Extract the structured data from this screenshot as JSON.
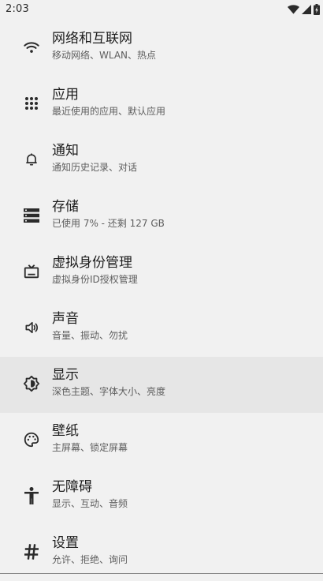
{
  "status_bar": {
    "time": "2:03",
    "icons": [
      "wifi-icon",
      "cell-signal-icon",
      "battery-icon"
    ]
  },
  "colors": {
    "background": "#f1f1f1",
    "highlight": "#e6e6e6",
    "title_text": "#1c1c1c",
    "subtitle_text": "#5e5e5e",
    "icon": "#2b2b2b"
  },
  "settings": [
    {
      "icon": "wifi-icon",
      "title": "网络和互联网",
      "subtitle": "移动网络、WLAN、热点"
    },
    {
      "icon": "apps-grid-icon",
      "title": "应用",
      "subtitle": "最近使用的应用、默认应用"
    },
    {
      "icon": "bell-icon",
      "title": "通知",
      "subtitle": "通知历史记录、对话"
    },
    {
      "icon": "storage-icon",
      "title": "存储",
      "subtitle": "已使用 7% - 还剩 127 GB"
    },
    {
      "icon": "tv-icon",
      "title": "虚拟身份管理",
      "subtitle": "虚拟身份ID授权管理"
    },
    {
      "icon": "speaker-icon",
      "title": "声音",
      "subtitle": "音量、振动、勿扰"
    },
    {
      "icon": "brightness-icon",
      "title": "显示",
      "subtitle": "深色主题、字体大小、亮度",
      "highlighted": true
    },
    {
      "icon": "palette-icon",
      "title": "壁纸",
      "subtitle": "主屏幕、锁定屏幕"
    },
    {
      "icon": "accessibility-icon",
      "title": "无障碍",
      "subtitle": "显示、互动、音频"
    },
    {
      "icon": "hash-icon",
      "title": "设置",
      "subtitle": "允许、拒绝、询问"
    }
  ]
}
